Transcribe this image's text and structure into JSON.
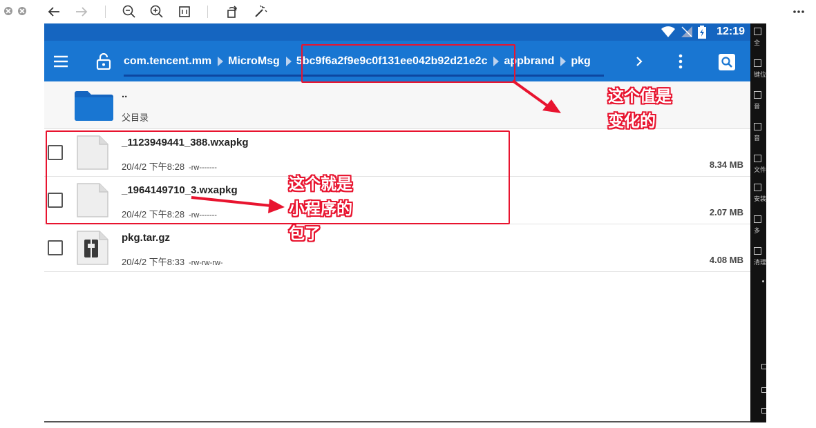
{
  "status_bar": {
    "time": "12:19"
  },
  "breadcrumbs": [
    "com.tencent.mm",
    "MicroMsg",
    "5bc9f6a2f9e9c0f131ee042b92d21e2c",
    "appbrand",
    "pkg"
  ],
  "parent": {
    "name": "..",
    "label": "父目录"
  },
  "files": [
    {
      "name": "_1123949441_388.wxapkg",
      "date": "20/4/2 下午8:28",
      "perm": "-rw-------",
      "size": "8.34 MB",
      "icon": "file-icon"
    },
    {
      "name": "_1964149710_3.wxapkg",
      "date": "20/4/2 下午8:28",
      "perm": "-rw-------",
      "size": "2.07 MB",
      "icon": "file-icon"
    },
    {
      "name": "pkg.tar.gz",
      "date": "20/4/2 下午8:33",
      "perm": "-rw-rw-rw-",
      "size": "4.08 MB",
      "icon": "archive-icon"
    }
  ],
  "side_panel": {
    "labels": [
      "全",
      "键位",
      "音",
      "音",
      "文件",
      "安装",
      "多",
      "清理"
    ]
  },
  "annotations": {
    "value_changes": [
      "这个值是",
      "变化的"
    ],
    "miniprogram_pkg": [
      "这个就是",
      "小程序的",
      "包了"
    ]
  },
  "colors": {
    "accent_blue": "#1976d2",
    "status_blue": "#1565c0",
    "annotation_red": "#e8142f"
  }
}
